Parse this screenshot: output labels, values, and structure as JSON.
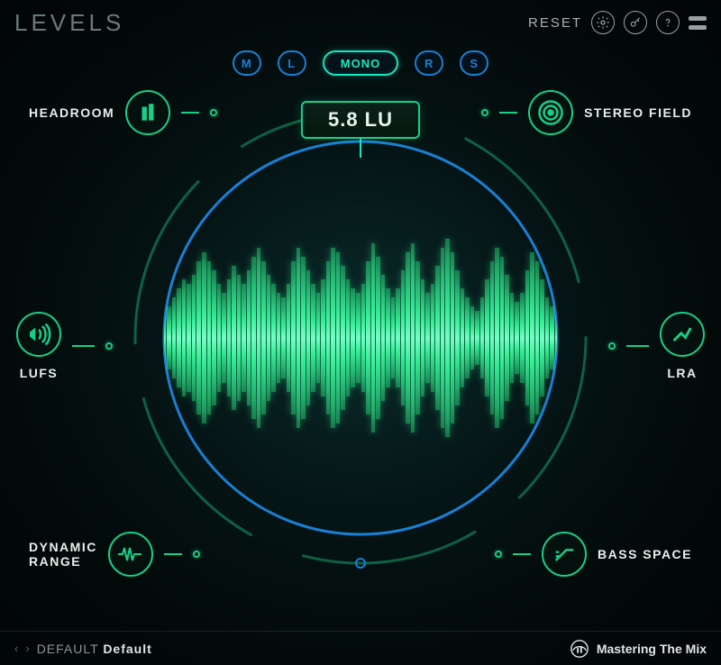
{
  "app_title": "LEVELS",
  "header": {
    "reset": "RESET"
  },
  "channels": {
    "m": "M",
    "l": "L",
    "mono": "MONO",
    "r": "R",
    "s": "S"
  },
  "readout": "5.8 LU",
  "metrics": {
    "headroom": "HEADROOM",
    "stereo_field": "STEREO FIELD",
    "lufs": "LUFS",
    "lra": "LRA",
    "dynamic_range": "DYNAMIC\nRANGE",
    "bass_space": "BASS SPACE"
  },
  "footer": {
    "preset_prefix": "DEFAULT",
    "preset_name": "Default",
    "brand": "Mastering The Mix"
  },
  "colors": {
    "green": "#16d088",
    "blue": "#1a7fd4",
    "cyan": "#18e8c0"
  }
}
